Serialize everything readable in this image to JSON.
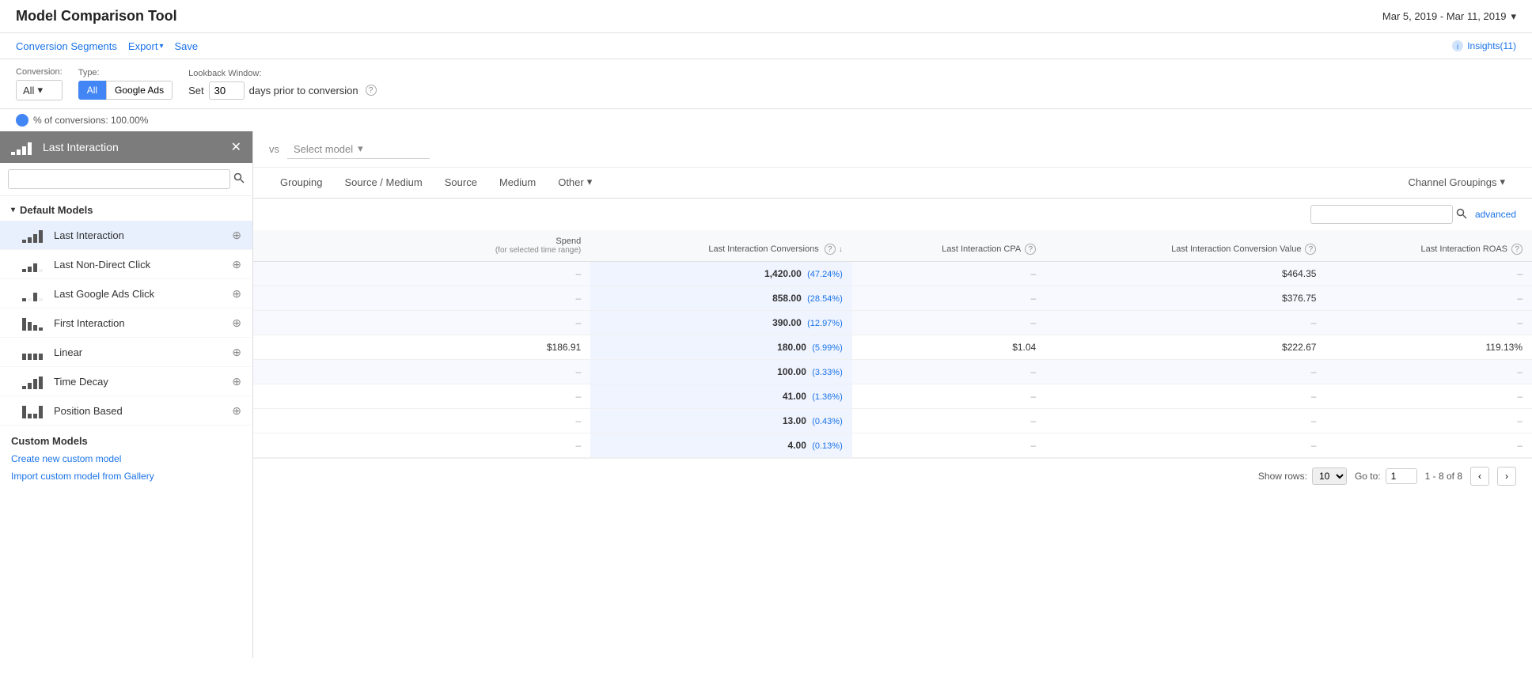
{
  "app": {
    "title": "Model Comparison Tool"
  },
  "dateRange": {
    "label": "Mar 5, 2019 - Mar 11, 2019",
    "arrow": "▾"
  },
  "toolbar": {
    "conversion_segments": "Conversion Segments",
    "export": "Export",
    "export_arrow": "▾",
    "save": "Save",
    "insights_count": "Insights(11)"
  },
  "controls": {
    "conversion_label": "Conversion:",
    "type_label": "Type:",
    "lookback_label": "Lookback Window:",
    "conversion_value": "All",
    "type_all": "All",
    "type_google_ads": "Google Ads",
    "lookback_set": "Set",
    "lookback_days": "30",
    "lookback_text": "days prior to conversion",
    "help_icon": "?",
    "pct_label": "% of conversions: 100.00%"
  },
  "leftPanel": {
    "selected_model": "Last Interaction",
    "search_placeholder": "",
    "default_models_label": "Default Models",
    "models": [
      {
        "id": "last-interaction",
        "label": "Last Interaction",
        "icon": "icon-last-interaction",
        "selected": true
      },
      {
        "id": "last-non-direct",
        "label": "Last Non-Direct Click",
        "icon": "icon-last-non-direct",
        "selected": false
      },
      {
        "id": "last-google-ads",
        "label": "Last Google Ads Click",
        "icon": "icon-last-google-ads",
        "selected": false
      },
      {
        "id": "first-interaction",
        "label": "First Interaction",
        "icon": "icon-first-interaction",
        "selected": false
      },
      {
        "id": "linear",
        "label": "Linear",
        "icon": "icon-linear",
        "selected": false
      },
      {
        "id": "time-decay",
        "label": "Time Decay",
        "icon": "icon-time-decay",
        "selected": false
      },
      {
        "id": "position-based",
        "label": "Position Based",
        "icon": "icon-position-based",
        "selected": false
      }
    ],
    "custom_models_label": "Custom Models",
    "create_link": "Create new custom model",
    "import_link": "Import custom model from Gallery"
  },
  "rightPanel": {
    "vs_label": "vs",
    "select_model_placeholder": "Select model",
    "select_arrow": "▾"
  },
  "navTabs": [
    {
      "id": "grouping",
      "label": "Grouping",
      "active": false
    },
    {
      "id": "source-medium",
      "label": "Source / Medium",
      "active": false
    },
    {
      "id": "source",
      "label": "Source",
      "active": false
    },
    {
      "id": "medium",
      "label": "Medium",
      "active": false
    },
    {
      "id": "other",
      "label": "Other",
      "active": false,
      "dropdown": true
    },
    {
      "id": "channel-groupings",
      "label": "Channel Groupings",
      "active": false,
      "dropdown": true
    }
  ],
  "tableSearch": {
    "placeholder": "",
    "advanced_label": "advanced"
  },
  "tableHeaders": {
    "spend": "Spend",
    "spend_sub": "(for selected time range)",
    "conversions": "Last Interaction Conversions",
    "cpa": "Last Interaction CPA",
    "conversion_value": "Last Interaction Conversion Value",
    "roas": "Last Interaction ROAS"
  },
  "tableRows": [
    {
      "spend": "–",
      "conversions": "1,420.00",
      "conv_pct": "(47.24%)",
      "cpa": "–",
      "conv_value": "$464.35",
      "roas": "–"
    },
    {
      "spend": "–",
      "conversions": "858.00",
      "conv_pct": "(28.54%)",
      "cpa": "–",
      "conv_value": "$376.75",
      "roas": "–"
    },
    {
      "spend": "–",
      "conversions": "390.00",
      "conv_pct": "(12.97%)",
      "cpa": "–",
      "conv_value": "–",
      "roas": "–"
    },
    {
      "spend": "$186.91",
      "conversions": "180.00",
      "conv_pct": "(5.99%)",
      "cpa": "$1.04",
      "conv_value": "$222.67",
      "roas": "119.13%"
    },
    {
      "spend": "–",
      "conversions": "100.00",
      "conv_pct": "(3.33%)",
      "cpa": "–",
      "conv_value": "–",
      "roas": "–"
    },
    {
      "spend": "–",
      "conversions": "41.00",
      "conv_pct": "(1.36%)",
      "cpa": "–",
      "conv_value": "–",
      "roas": "–"
    },
    {
      "spend": "–",
      "conversions": "13.00",
      "conv_pct": "(0.43%)",
      "cpa": "–",
      "conv_value": "–",
      "roas": "–"
    },
    {
      "spend": "–",
      "conversions": "4.00",
      "conv_pct": "(0.13%)",
      "cpa": "–",
      "conv_value": "–",
      "roas": "–"
    }
  ],
  "pagination": {
    "show_rows_label": "Show rows:",
    "rows_value": "10",
    "goto_label": "Go to:",
    "goto_value": "1",
    "page_range": "1 - 8 of 8"
  }
}
